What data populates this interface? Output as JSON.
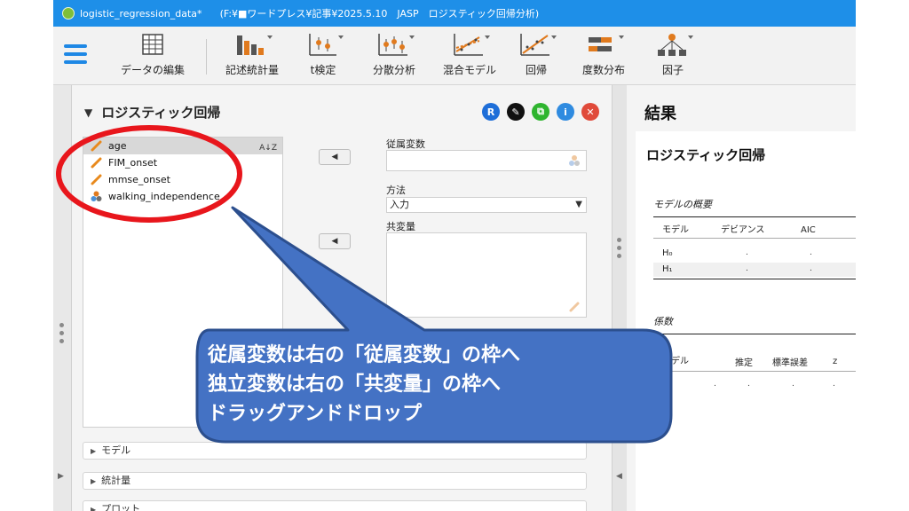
{
  "titlebar": {
    "file_name": "logistic_regression_data*",
    "path": "(F:¥■ワードプレス¥記事¥2025.5.10　JASP　ロジスティック回帰分析)"
  },
  "toolbar": {
    "items": [
      {
        "label": "データの編集",
        "icon": "spreadsheet-icon"
      },
      {
        "label": "記述統計量",
        "icon": "descriptives-icon"
      },
      {
        "label": "t検定",
        "icon": "ttest-icon"
      },
      {
        "label": "分散分析",
        "icon": "anova-icon"
      },
      {
        "label": "混合モデル",
        "icon": "mixed-models-icon"
      },
      {
        "label": "回帰",
        "icon": "regression-icon"
      },
      {
        "label": "度数分布",
        "icon": "frequencies-icon"
      },
      {
        "label": "因子",
        "icon": "factor-icon"
      }
    ]
  },
  "analysis": {
    "title": "ロジスティック回帰",
    "header_icons": [
      {
        "glyph": "R",
        "color": "#1e6ed8",
        "name": "r-syntax-icon"
      },
      {
        "glyph": "✎",
        "color": "#111111",
        "name": "edit-title-icon"
      },
      {
        "glyph": "⧉",
        "color": "#2fb52f",
        "name": "duplicate-icon"
      },
      {
        "glyph": "i",
        "color": "#2f8be0",
        "name": "info-icon"
      },
      {
        "glyph": "✕",
        "color": "#e04a3a",
        "name": "close-analysis-icon"
      }
    ],
    "variables": [
      {
        "name": "age",
        "type": "scale"
      },
      {
        "name": "FIM_onset",
        "type": "scale"
      },
      {
        "name": "mmse_onset",
        "type": "scale"
      },
      {
        "name": "walking_independence",
        "type": "nominal"
      }
    ],
    "sort_glyph": "A↓Z",
    "move_glyph": "◀",
    "dependent_label": "従属変数",
    "method_label": "方法",
    "method_value": "入力",
    "covariates_label": "共変量",
    "sections": [
      {
        "label": "モデル"
      },
      {
        "label": "統計量"
      },
      {
        "label": "プロット"
      }
    ]
  },
  "results": {
    "title": "結果",
    "heading": "ロジスティック回帰",
    "model_summary": {
      "title": "モデルの概要",
      "headers": [
        "モデル",
        "デビアンス",
        "AIC"
      ],
      "rows": [
        "H₀",
        "H₁"
      ],
      "placeholder": "."
    },
    "coefficients": {
      "title": "係数",
      "headers": [
        "モデル",
        "推定",
        "標準誤差",
        "z"
      ],
      "placeholder": "."
    }
  },
  "annotation": {
    "lines": [
      "従属変数は右の「従属変数」の枠へ",
      "独立変数は右の「共変量」の枠へ",
      "ドラッグアンドドロップ"
    ],
    "ellipse_color": "#e8161c",
    "callout_fill": "#4472c4",
    "callout_border": "#2c4f8e"
  }
}
